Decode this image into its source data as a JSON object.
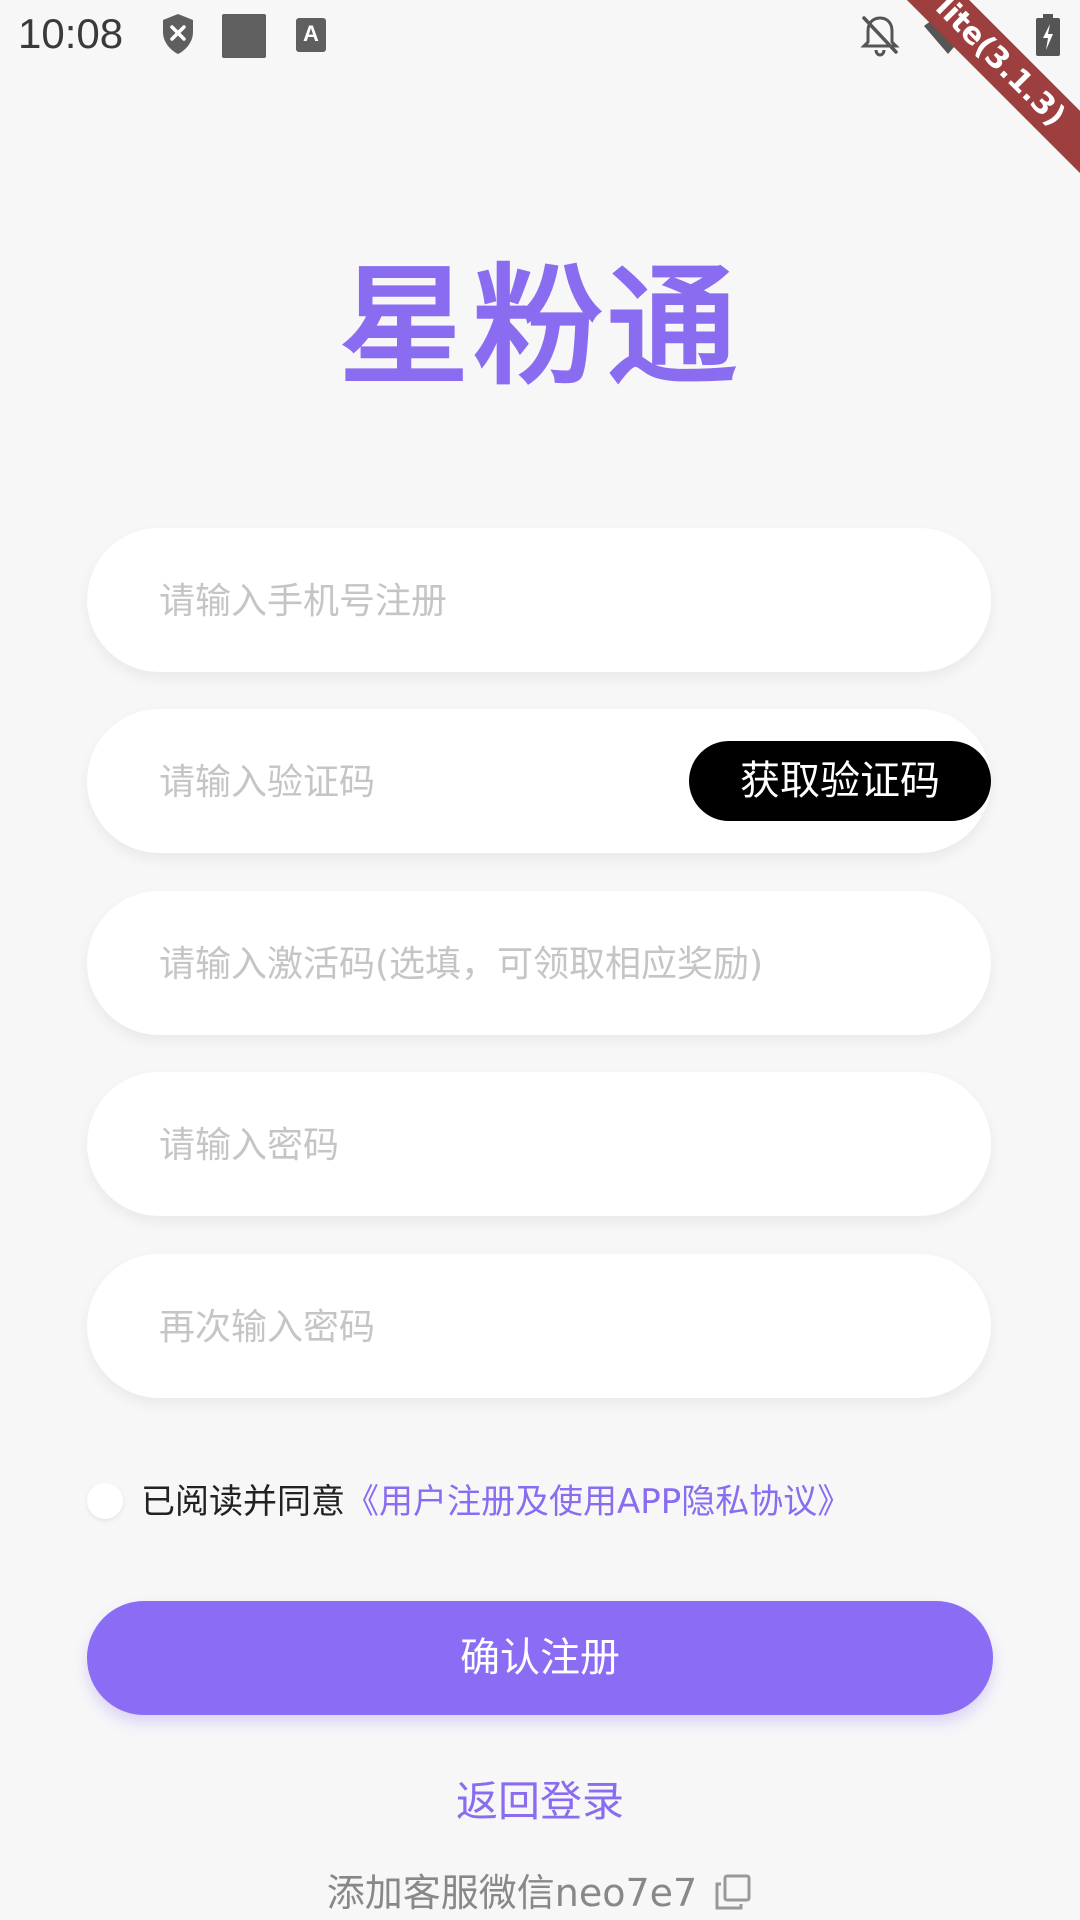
{
  "status_bar": {
    "time": "10:08",
    "icons": [
      "shield-x-icon",
      "square-icon",
      "font-icon",
      "bell-off-icon",
      "wifi-icon",
      "signal-icon",
      "battery-icon"
    ],
    "font_icon_glyph": "A"
  },
  "debug_banner": "lite(3.1.3)",
  "logo": "星粉通",
  "form": {
    "phone_placeholder": "请输入手机号注册",
    "code_placeholder": "请输入验证码",
    "get_code_label": "获取验证码",
    "activation_placeholder": "请输入激活码(选填，可领取相应奖励)",
    "password_placeholder": "请输入密码",
    "confirm_password_placeholder": "再次输入密码"
  },
  "agreement": {
    "prefix": "已阅读并同意",
    "link": "《用户注册及使用APP隐私协议》",
    "checked": false
  },
  "confirm_label": "确认注册",
  "back_login_label": "返回登录",
  "wechat_label": "添加客服微信neo7e7",
  "colors": {
    "accent": "#8a6cf5",
    "background": "#f7f7f8",
    "code_button": "#000000",
    "ribbon": "#9d3f3f"
  }
}
